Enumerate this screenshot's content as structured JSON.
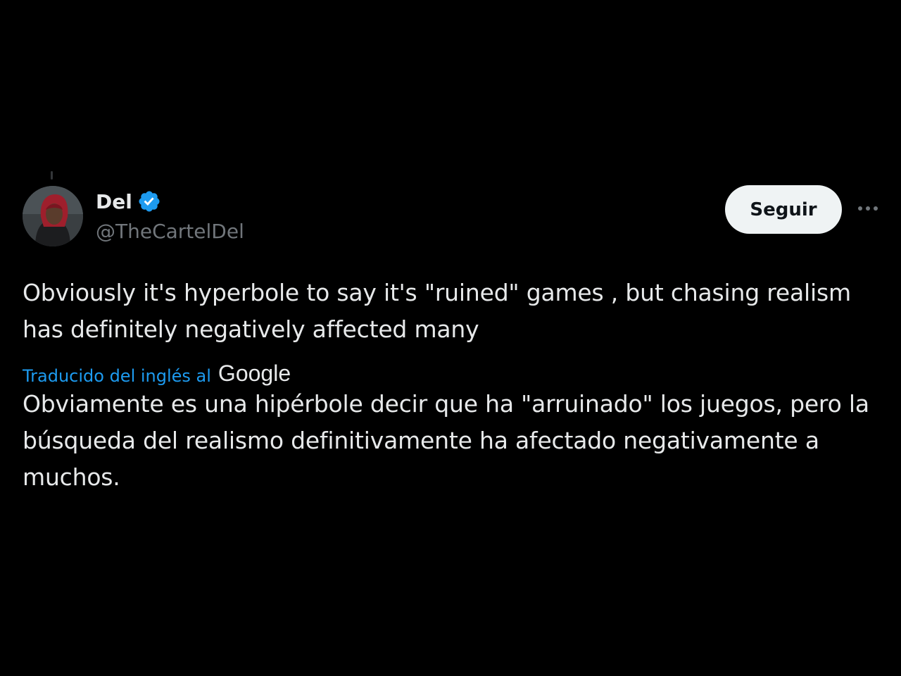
{
  "tweet": {
    "author": {
      "display_name": "Del",
      "handle": "@TheCartelDel",
      "verified": true
    },
    "follow_label": "Seguir",
    "text": "Obviously it's hyperbole to say it's \"ruined\" games , but chasing realism has definitely negatively affected many",
    "translation": {
      "label": "Traducido del inglés al",
      "provider": "Google",
      "text": "Obviamente es una hipérbole decir que ha \"arruinado\" los juegos, pero la búsqueda del realismo definitivamente ha afectado negativamente a muchos."
    }
  },
  "colors": {
    "background": "#000000",
    "text_primary": "#e7e9ea",
    "text_secondary": "#71767b",
    "accent": "#1d9bf0",
    "button_bg": "#eff3f4"
  },
  "icons": {
    "verified": "verified-badge-icon",
    "more": "more-options-icon"
  }
}
